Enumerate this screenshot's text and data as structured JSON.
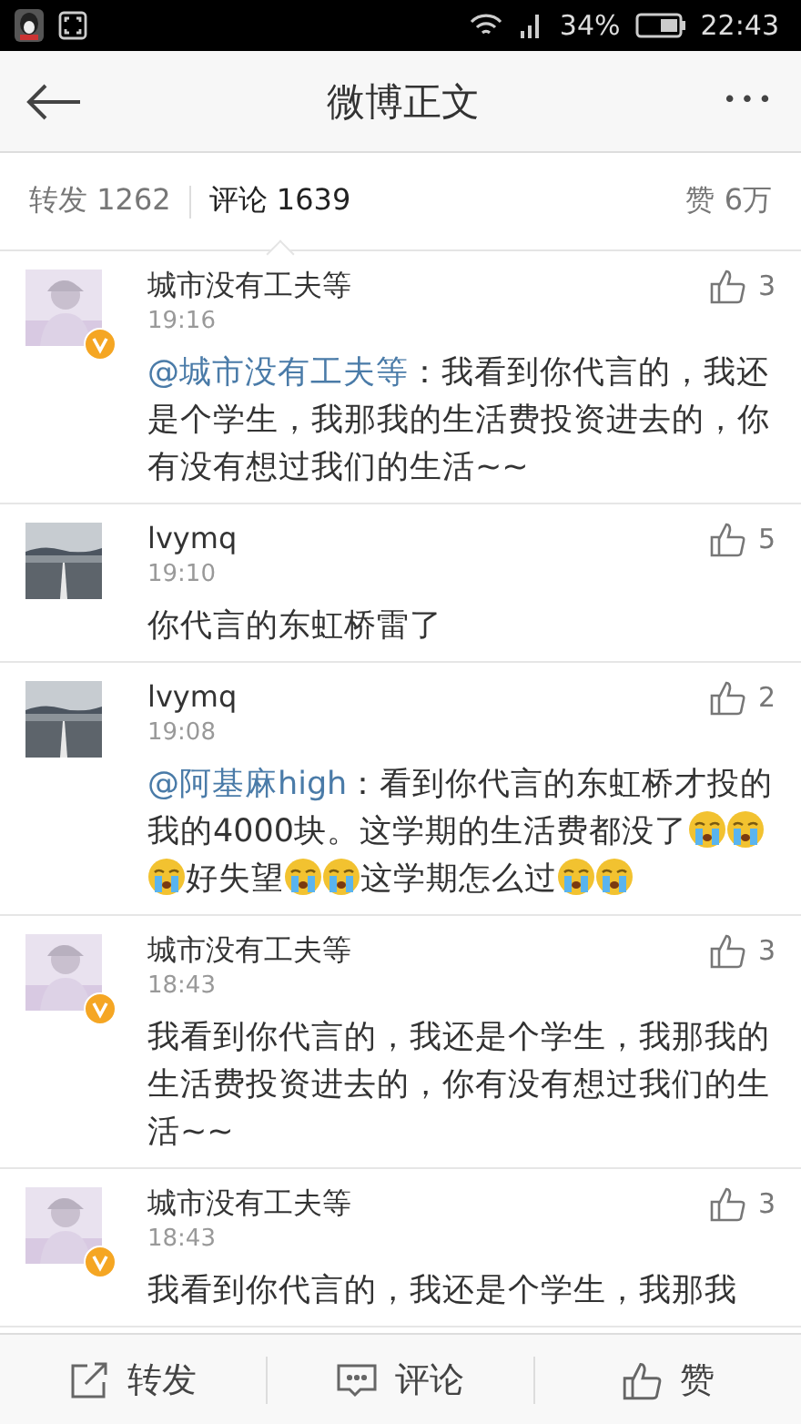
{
  "status_bar": {
    "battery": "34%",
    "time": "22:43"
  },
  "header": {
    "title": "微博正文",
    "more": "•••"
  },
  "tabs": [
    {
      "label": "转发 1262",
      "selected": false
    },
    {
      "label": "评论 1639",
      "selected": true
    }
  ],
  "likes_total": "赞 6万",
  "comments": [
    {
      "user": "城市没有工夫等",
      "verified": true,
      "time": "19:16",
      "likes": "3",
      "avatar": {
        "kind": "picture"
      },
      "body": [
        {
          "kind": "mention",
          "text": "@城市没有工夫等"
        },
        {
          "kind": "text",
          "text": "：我看到你代言的，我还是个学生，我那我的生活费投资进去的，你有没有想过我们的生活~~"
        }
      ]
    },
    {
      "user": "lvymq",
      "verified": false,
      "time": "19:10",
      "likes": "5",
      "avatar": {
        "kind": "picture"
      },
      "body": [
        {
          "kind": "text",
          "text": "你代言的东虹桥雷了"
        }
      ]
    },
    {
      "user": "lvymq",
      "verified": false,
      "time": "19:08",
      "likes": "2",
      "avatar": {
        "kind": "picture"
      },
      "body": [
        {
          "kind": "mention",
          "text": "@阿基麻high"
        },
        {
          "kind": "text",
          "text": "：看到你代言的东虹桥才投的我的4000块。这学期的生活费都没了"
        },
        {
          "kind": "emoji"
        },
        {
          "kind": "emoji"
        },
        {
          "kind": "emoji"
        },
        {
          "kind": "text",
          "text": "好失望"
        },
        {
          "kind": "emoji"
        },
        {
          "kind": "emoji"
        },
        {
          "kind": "text",
          "text": "这学期怎么过"
        },
        {
          "kind": "emoji"
        },
        {
          "kind": "emoji"
        }
      ]
    },
    {
      "user": "城市没有工夫等",
      "verified": true,
      "time": "18:43",
      "likes": "3",
      "avatar": {
        "kind": "picture"
      },
      "body": [
        {
          "kind": "text",
          "text": "我看到你代言的，我还是个学生，我那我的生活费投资进去的，你有没有想过我们的生活~~"
        }
      ]
    },
    {
      "user": "城市没有工夫等",
      "verified": true,
      "time": "18:43",
      "likes": "3",
      "avatar": {
        "kind": "picture"
      },
      "body": [
        {
          "kind": "text",
          "text": "我看到你代言的，我还是个学生，我那我"
        }
      ]
    }
  ],
  "toolbar": [
    {
      "kind": "repost",
      "label": "转发"
    },
    {
      "kind": "comment",
      "label": "评论"
    },
    {
      "kind": "like",
      "label": "赞"
    }
  ]
}
